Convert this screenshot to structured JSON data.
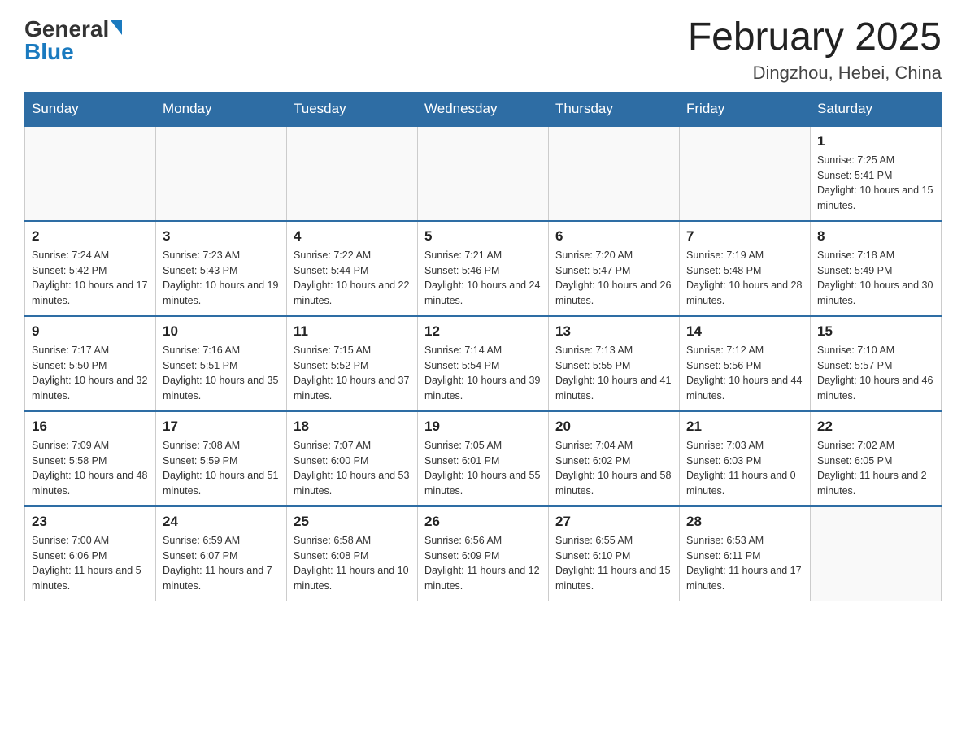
{
  "header": {
    "logo_general": "General",
    "logo_blue": "Blue",
    "title": "February 2025",
    "subtitle": "Dingzhou, Hebei, China"
  },
  "days_of_week": [
    "Sunday",
    "Monday",
    "Tuesday",
    "Wednesday",
    "Thursday",
    "Friday",
    "Saturday"
  ],
  "weeks": [
    [
      {
        "day": "",
        "info": ""
      },
      {
        "day": "",
        "info": ""
      },
      {
        "day": "",
        "info": ""
      },
      {
        "day": "",
        "info": ""
      },
      {
        "day": "",
        "info": ""
      },
      {
        "day": "",
        "info": ""
      },
      {
        "day": "1",
        "info": "Sunrise: 7:25 AM\nSunset: 5:41 PM\nDaylight: 10 hours and 15 minutes."
      }
    ],
    [
      {
        "day": "2",
        "info": "Sunrise: 7:24 AM\nSunset: 5:42 PM\nDaylight: 10 hours and 17 minutes."
      },
      {
        "day": "3",
        "info": "Sunrise: 7:23 AM\nSunset: 5:43 PM\nDaylight: 10 hours and 19 minutes."
      },
      {
        "day": "4",
        "info": "Sunrise: 7:22 AM\nSunset: 5:44 PM\nDaylight: 10 hours and 22 minutes."
      },
      {
        "day": "5",
        "info": "Sunrise: 7:21 AM\nSunset: 5:46 PM\nDaylight: 10 hours and 24 minutes."
      },
      {
        "day": "6",
        "info": "Sunrise: 7:20 AM\nSunset: 5:47 PM\nDaylight: 10 hours and 26 minutes."
      },
      {
        "day": "7",
        "info": "Sunrise: 7:19 AM\nSunset: 5:48 PM\nDaylight: 10 hours and 28 minutes."
      },
      {
        "day": "8",
        "info": "Sunrise: 7:18 AM\nSunset: 5:49 PM\nDaylight: 10 hours and 30 minutes."
      }
    ],
    [
      {
        "day": "9",
        "info": "Sunrise: 7:17 AM\nSunset: 5:50 PM\nDaylight: 10 hours and 32 minutes."
      },
      {
        "day": "10",
        "info": "Sunrise: 7:16 AM\nSunset: 5:51 PM\nDaylight: 10 hours and 35 minutes."
      },
      {
        "day": "11",
        "info": "Sunrise: 7:15 AM\nSunset: 5:52 PM\nDaylight: 10 hours and 37 minutes."
      },
      {
        "day": "12",
        "info": "Sunrise: 7:14 AM\nSunset: 5:54 PM\nDaylight: 10 hours and 39 minutes."
      },
      {
        "day": "13",
        "info": "Sunrise: 7:13 AM\nSunset: 5:55 PM\nDaylight: 10 hours and 41 minutes."
      },
      {
        "day": "14",
        "info": "Sunrise: 7:12 AM\nSunset: 5:56 PM\nDaylight: 10 hours and 44 minutes."
      },
      {
        "day": "15",
        "info": "Sunrise: 7:10 AM\nSunset: 5:57 PM\nDaylight: 10 hours and 46 minutes."
      }
    ],
    [
      {
        "day": "16",
        "info": "Sunrise: 7:09 AM\nSunset: 5:58 PM\nDaylight: 10 hours and 48 minutes."
      },
      {
        "day": "17",
        "info": "Sunrise: 7:08 AM\nSunset: 5:59 PM\nDaylight: 10 hours and 51 minutes."
      },
      {
        "day": "18",
        "info": "Sunrise: 7:07 AM\nSunset: 6:00 PM\nDaylight: 10 hours and 53 minutes."
      },
      {
        "day": "19",
        "info": "Sunrise: 7:05 AM\nSunset: 6:01 PM\nDaylight: 10 hours and 55 minutes."
      },
      {
        "day": "20",
        "info": "Sunrise: 7:04 AM\nSunset: 6:02 PM\nDaylight: 10 hours and 58 minutes."
      },
      {
        "day": "21",
        "info": "Sunrise: 7:03 AM\nSunset: 6:03 PM\nDaylight: 11 hours and 0 minutes."
      },
      {
        "day": "22",
        "info": "Sunrise: 7:02 AM\nSunset: 6:05 PM\nDaylight: 11 hours and 2 minutes."
      }
    ],
    [
      {
        "day": "23",
        "info": "Sunrise: 7:00 AM\nSunset: 6:06 PM\nDaylight: 11 hours and 5 minutes."
      },
      {
        "day": "24",
        "info": "Sunrise: 6:59 AM\nSunset: 6:07 PM\nDaylight: 11 hours and 7 minutes."
      },
      {
        "day": "25",
        "info": "Sunrise: 6:58 AM\nSunset: 6:08 PM\nDaylight: 11 hours and 10 minutes."
      },
      {
        "day": "26",
        "info": "Sunrise: 6:56 AM\nSunset: 6:09 PM\nDaylight: 11 hours and 12 minutes."
      },
      {
        "day": "27",
        "info": "Sunrise: 6:55 AM\nSunset: 6:10 PM\nDaylight: 11 hours and 15 minutes."
      },
      {
        "day": "28",
        "info": "Sunrise: 6:53 AM\nSunset: 6:11 PM\nDaylight: 11 hours and 17 minutes."
      },
      {
        "day": "",
        "info": ""
      }
    ]
  ]
}
